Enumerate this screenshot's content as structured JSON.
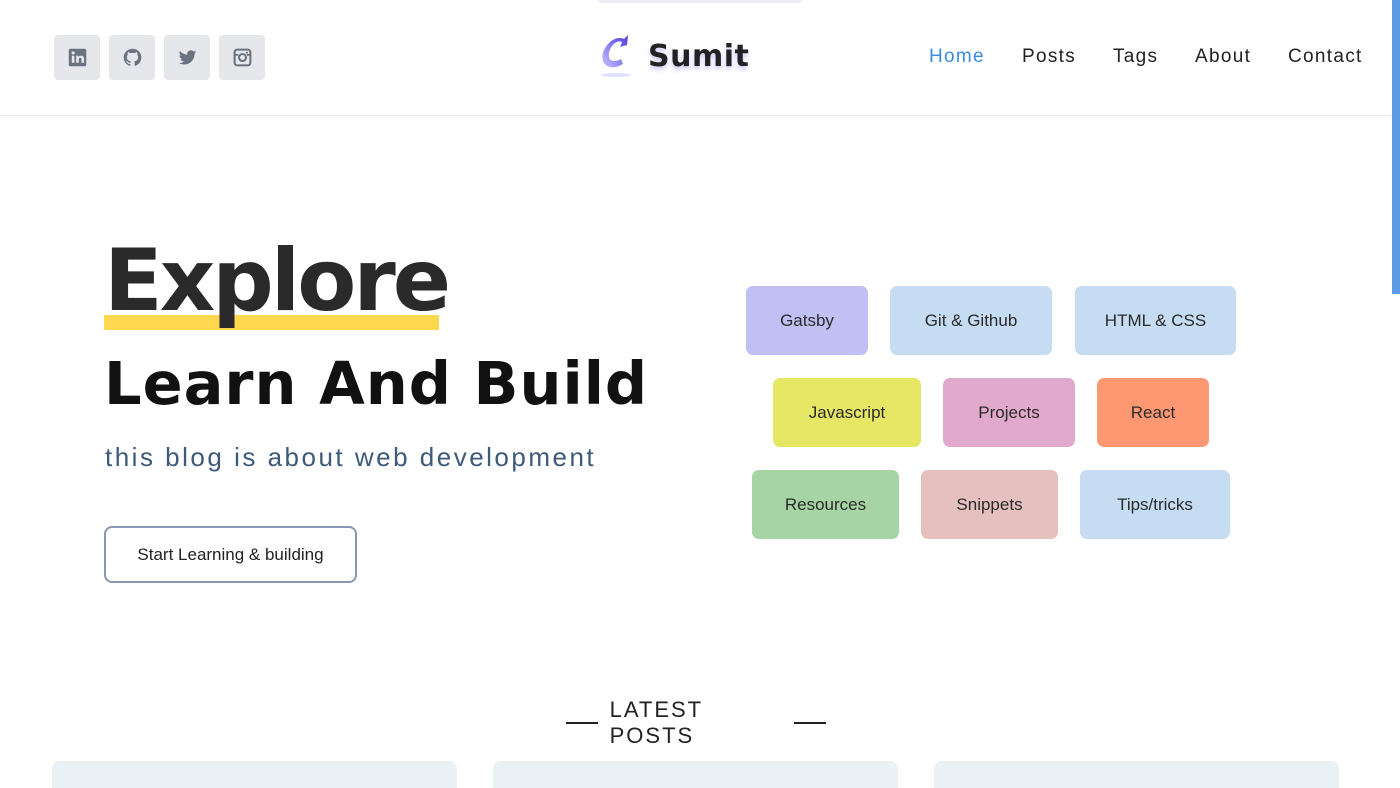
{
  "header": {
    "brand": "Sumit",
    "socials": [
      {
        "icon": "linkedin-icon"
      },
      {
        "icon": "github-icon"
      },
      {
        "icon": "twitter-icon"
      },
      {
        "icon": "instagram-icon"
      }
    ],
    "nav": [
      {
        "label": "Home",
        "active": true
      },
      {
        "label": "Posts",
        "active": false
      },
      {
        "label": "Tags",
        "active": false
      },
      {
        "label": "About",
        "active": false
      },
      {
        "label": "Contact",
        "active": false
      }
    ]
  },
  "hero": {
    "title": "Explore",
    "subtitle": "Learn And Build",
    "tagline": "this blog is about web development",
    "cta": "Start Learning & building"
  },
  "tags": [
    {
      "label": "Gatsby",
      "color": "#c0c0f4"
    },
    {
      "label": "Git & Github",
      "color": "#c5dcf2"
    },
    {
      "label": "HTML & CSS",
      "color": "#c5dcf2"
    },
    {
      "label": "Javascript",
      "color": "#e6e765"
    },
    {
      "label": "Projects",
      "color": "#e1aacd"
    },
    {
      "label": "React",
      "color": "#fe9873"
    },
    {
      "label": "Resources",
      "color": "#a6d4a4"
    },
    {
      "label": "Snippets",
      "color": "#e6c0bf"
    },
    {
      "label": "Tips/tricks",
      "color": "#c5dcf2"
    }
  ],
  "latest_posts": {
    "heading": "LATEST POSTS"
  },
  "colors": {
    "accent": "#3b8ce0",
    "highlight": "#ffd84f",
    "tagline": "#3d5a7a"
  }
}
